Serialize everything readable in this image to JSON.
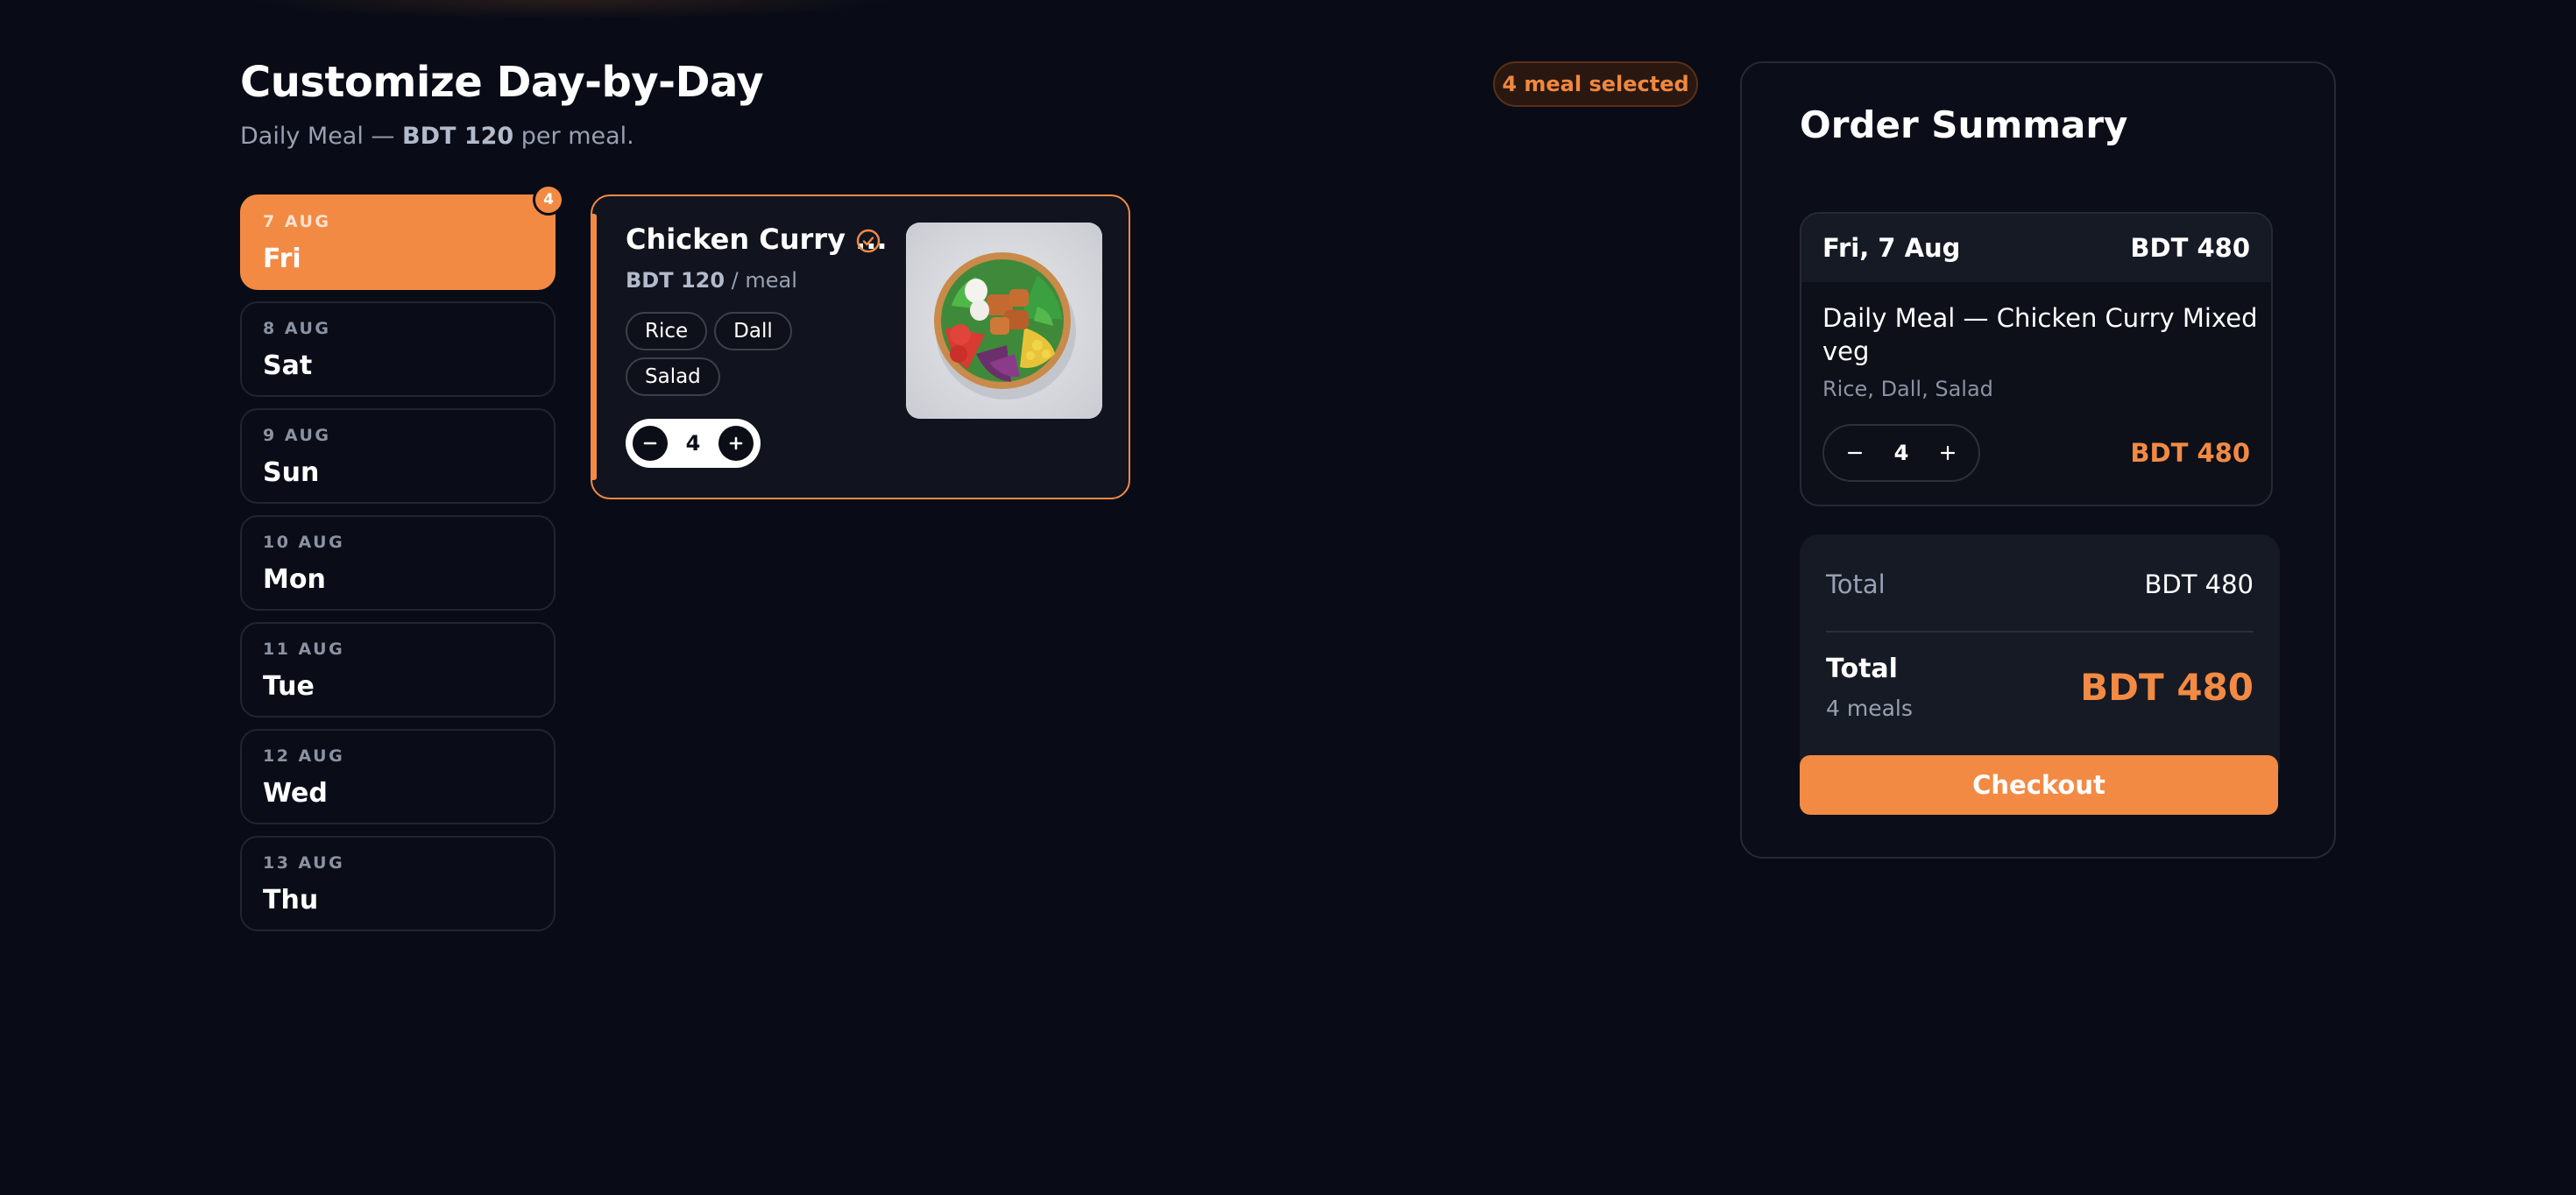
{
  "header": {
    "title": "Customize Day-by-Day",
    "subtitle_prefix": "Daily Meal — ",
    "subtitle_price": "BDT 120",
    "subtitle_suffix": " per meal.",
    "selected_badge": "4 meal selected"
  },
  "days": [
    {
      "date": "7 AUG",
      "name": "Fri",
      "active": true,
      "count": "4"
    },
    {
      "date": "8 AUG",
      "name": "Sat"
    },
    {
      "date": "9 AUG",
      "name": "Sun"
    },
    {
      "date": "10 AUG",
      "name": "Mon"
    },
    {
      "date": "11 AUG",
      "name": "Tue"
    },
    {
      "date": "12 AUG",
      "name": "Wed"
    },
    {
      "date": "13 AUG",
      "name": "Thu"
    }
  ],
  "meal": {
    "name": "Chicken Curry ...",
    "price": "BDT 120",
    "price_unit": " / meal",
    "tags": [
      "Rice",
      "Dall",
      "Salad"
    ],
    "quantity": "4",
    "selected": true
  },
  "summary": {
    "title": "Order Summary",
    "item": {
      "day": "Fri, 7 Aug",
      "day_total": "BDT 480",
      "name": "Daily Meal — Chicken Curry Mixed veg",
      "sides": "Rice, Dall, Salad",
      "quantity": "4",
      "price": "BDT 480"
    },
    "subtotal_label": "Total",
    "subtotal_value": "BDT 480",
    "grand_label": "Total",
    "grand_count": "4 meals",
    "grand_value": "BDT 480",
    "checkout_label": "Checkout"
  },
  "colors": {
    "accent": "#f28a44",
    "background": "#090c16",
    "card": "#11141e"
  }
}
